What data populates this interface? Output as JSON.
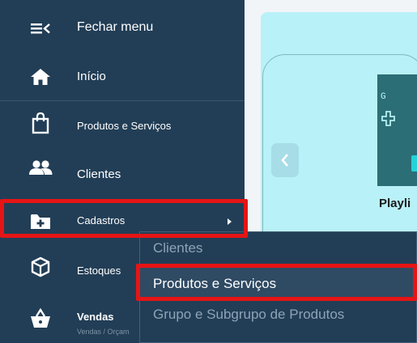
{
  "sidebar": {
    "close_menu": {
      "label": "Fechar menu",
      "icon": "menu-collapse-icon"
    },
    "home": {
      "label": "Início",
      "icon": "home-icon"
    },
    "products": {
      "label": "Produtos e Serviços",
      "icon": "shopping-bag-icon"
    },
    "clients": {
      "label": "Clientes",
      "icon": "users-icon"
    },
    "registrations": {
      "label": "Cadastros",
      "icon": "folder-plus-icon"
    },
    "stock": {
      "label": "Estoques",
      "icon": "box-icon"
    },
    "sales": {
      "label": "Vendas",
      "sublabel": "Vendas / Orçam",
      "icon": "basket-icon"
    }
  },
  "submenu": {
    "items": [
      "Clientes",
      "Produtos e Serviços",
      "Grupo e Subgrupo de Produtos"
    ],
    "active_index": 1
  },
  "main": {
    "thumbnail_letter": "G",
    "card_title": "Playli"
  },
  "colors": {
    "sidebar_bg": "#223e56",
    "panel_bg": "#b9f1f8",
    "highlight": "#e51515",
    "submenu_text": "#8ea3b6"
  }
}
